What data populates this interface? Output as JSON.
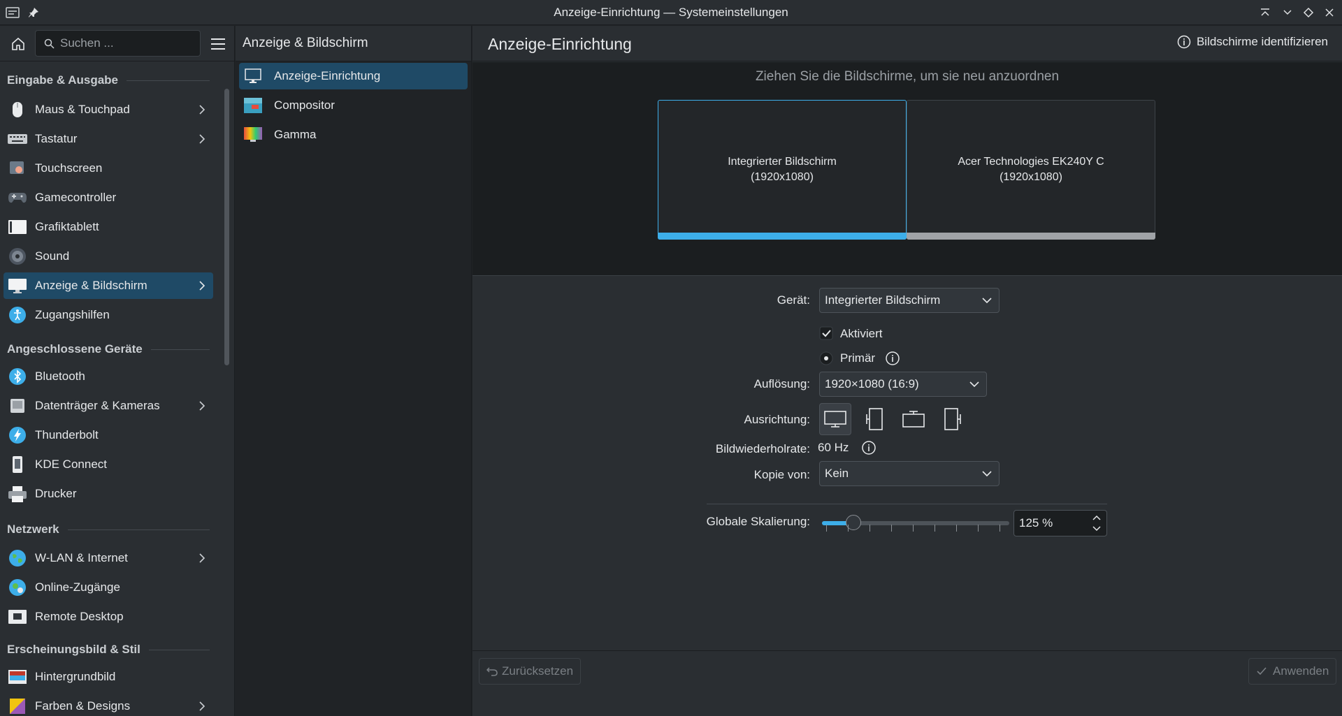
{
  "window": {
    "title": "Anzeige-Einrichtung — Systemeinstellungen"
  },
  "sidebar": {
    "search_placeholder": "Suchen ...",
    "categories": [
      {
        "label": "Eingabe & Ausgabe",
        "items": [
          {
            "label": "Maus & Touchpad",
            "icon": "mouse-icon",
            "chevron": true
          },
          {
            "label": "Tastatur",
            "icon": "keyboard-icon",
            "chevron": true
          },
          {
            "label": "Touchscreen",
            "icon": "touchscreen-icon",
            "chevron": false
          },
          {
            "label": "Gamecontroller",
            "icon": "gamepad-icon",
            "chevron": false
          },
          {
            "label": "Grafiktablett",
            "icon": "tablet-icon",
            "chevron": false
          },
          {
            "label": "Sound",
            "icon": "speaker-icon",
            "chevron": false
          },
          {
            "label": "Anzeige & Bildschirm",
            "icon": "display-icon",
            "chevron": true,
            "active": true
          },
          {
            "label": "Zugangshilfen",
            "icon": "accessibility-icon",
            "chevron": false
          }
        ]
      },
      {
        "label": "Angeschlossene Geräte",
        "items": [
          {
            "label": "Bluetooth",
            "icon": "bluetooth-icon",
            "chevron": false
          },
          {
            "label": "Datenträger & Kameras",
            "icon": "drive-icon",
            "chevron": true
          },
          {
            "label": "Thunderbolt",
            "icon": "thunderbolt-icon",
            "chevron": false
          },
          {
            "label": "KDE Connect",
            "icon": "kdeconnect-icon",
            "chevron": false
          },
          {
            "label": "Drucker",
            "icon": "printer-icon",
            "chevron": false
          }
        ]
      },
      {
        "label": "Netzwerk",
        "items": [
          {
            "label": "W-LAN & Internet",
            "icon": "globe-icon",
            "chevron": true
          },
          {
            "label": "Online-Zugänge",
            "icon": "online-accounts-icon",
            "chevron": false
          },
          {
            "label": "Remote Desktop",
            "icon": "remote-desktop-icon",
            "chevron": false
          }
        ]
      },
      {
        "label": "Erscheinungsbild & Stil",
        "items": [
          {
            "label": "Hintergrundbild",
            "icon": "wallpaper-icon",
            "chevron": false
          },
          {
            "label": "Farben & Designs",
            "icon": "colors-icon",
            "chevron": true
          }
        ]
      }
    ]
  },
  "midpane": {
    "title": "Anzeige & Bildschirm",
    "items": [
      {
        "label": "Anzeige-Einrichtung",
        "active": true
      },
      {
        "label": "Compositor",
        "active": false
      },
      {
        "label": "Gamma",
        "active": false
      }
    ]
  },
  "main": {
    "title": "Anzeige-Einrichtung",
    "identify_label": "Bildschirme identifizieren",
    "arrange_hint": "Ziehen Sie die Bildschirme, um sie neu anzuordnen",
    "monitors": [
      {
        "name": "Integrierter Bildschirm",
        "resolution": "(1920x1080)",
        "selected": true
      },
      {
        "name": "Acer Technologies EK240Y C",
        "resolution": "(1920x1080)",
        "selected": false
      }
    ],
    "form": {
      "device_label": "Gerät:",
      "device_value": "Integrierter Bildschirm",
      "enabled_label": "Aktiviert",
      "enabled": true,
      "primary_label": "Primär",
      "primary": true,
      "resolution_label": "Auflösung:",
      "resolution_value": "1920×1080 (16:9)",
      "orientation_label": "Ausrichtung:",
      "refresh_label": "Bildwiederholrate:",
      "refresh_value": "60 Hz",
      "mirror_label": "Kopie von:",
      "mirror_value": "Kein",
      "scale_label": "Globale Skalierung:",
      "scale_value": "125 %",
      "scale_fraction": 0.125
    },
    "footer": {
      "reset_label": "Zurücksetzen",
      "apply_label": "Anwenden"
    }
  },
  "colors": {
    "accent": "#3daee9",
    "active_bg": "#1f4a66",
    "panel": "#2a2e32",
    "dark": "#1b1e20"
  }
}
